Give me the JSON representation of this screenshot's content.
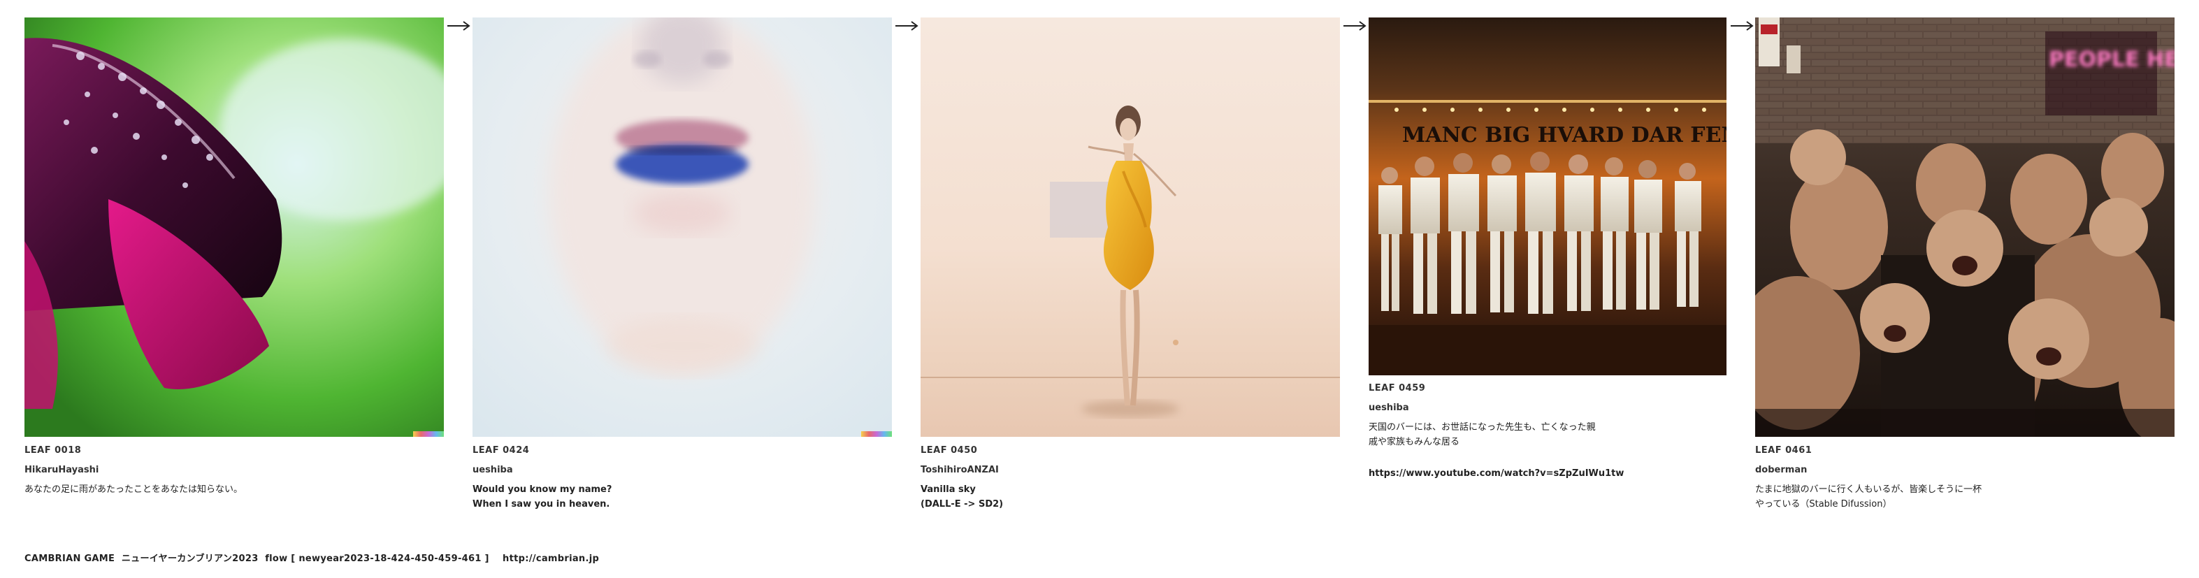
{
  "leaves": [
    {
      "id": "LEAF 0018",
      "author": "HikaruHayashi",
      "caption": "あなたの足に雨があたったことをあなたは知らない。",
      "image": "rain-drops-on-purple-flower-photo"
    },
    {
      "id": "LEAF 0424",
      "author": "ueshiba",
      "caption": "Would you know my name?\nWhen I saw you in heaven.",
      "image": "faded-face-blue-lips-photo"
    },
    {
      "id": "LEAF 0450",
      "author": "ToshihiroANZAI",
      "caption": "Vanilla sky\n(DALL-E -> SD2)",
      "image": "woman-in-yellow-dress-illustration"
    },
    {
      "id": "LEAF 0459",
      "author": "ueshiba",
      "caption": "天国のバーには、お世話になった先生も、亡くなった親\n戚や家族もみんな居る",
      "link": "https://www.youtube.com/watch?v=sZpZuIWu1tw",
      "image": "men-in-white-suits-photo",
      "image_text": "MANC BIG HVARD DAR FEME AL HEA HAVEN HAENOR"
    },
    {
      "id": "LEAF 0461",
      "author": "doberman",
      "caption": "たまに地獄のバーに行く人もいるが、皆楽しそうに一杯\nやっている（Stable Difussion）",
      "image": "crowded-dark-bar-photo",
      "image_text": "PEOPLE HELL"
    }
  ],
  "footer": "CAMBRIAN GAME  ニューイヤーカンブリアン2023  flow [ newyear2023-18-424-450-459-461 ]    http://cambrian.jp",
  "icons": {
    "arrow": "right-arrow-icon"
  }
}
